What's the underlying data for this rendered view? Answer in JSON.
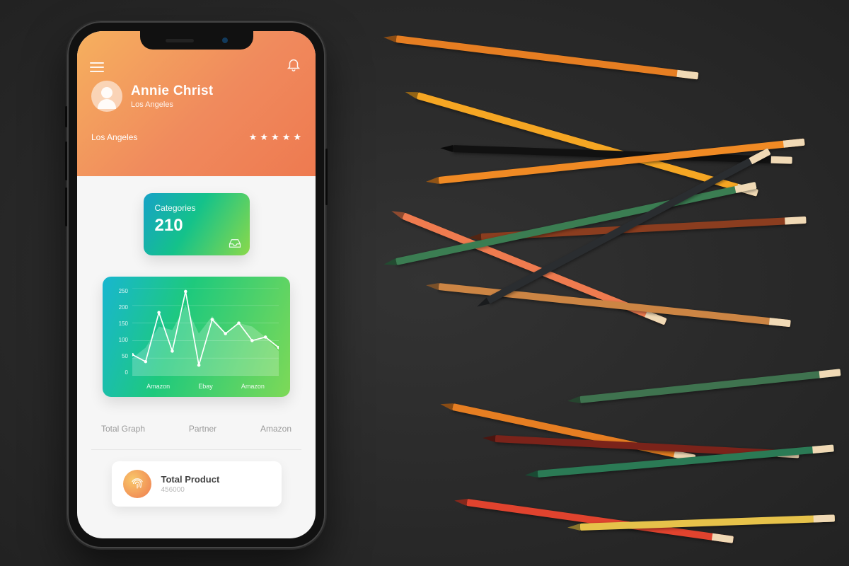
{
  "profile": {
    "name": "Annie Christ",
    "location": "Los Angeles"
  },
  "header": {
    "location_repeat": "Los Angeles",
    "stars": 5
  },
  "categories": {
    "label": "Categories",
    "value": "210"
  },
  "chart_data": {
    "type": "line",
    "x_categories": [
      "Amazon",
      "Ebay",
      "Amazon"
    ],
    "y_ticks": [
      250,
      200,
      150,
      100,
      50,
      0
    ],
    "ylim": [
      0,
      250
    ],
    "series": [
      {
        "name": "line",
        "values": [
          60,
          40,
          180,
          70,
          240,
          30,
          160,
          120,
          150,
          100,
          110,
          80
        ]
      },
      {
        "name": "area",
        "values": [
          50,
          80,
          140,
          130,
          200,
          120,
          170,
          120,
          150,
          140,
          110,
          70
        ]
      }
    ]
  },
  "tabs": {
    "items": [
      {
        "label": "Total Graph"
      },
      {
        "label": "Partner"
      },
      {
        "label": "Amazon"
      }
    ]
  },
  "total_product": {
    "label": "Total Product",
    "value": "456000"
  },
  "colors": {
    "header_grad_a": "#f6b05e",
    "header_grad_b": "#ee7a50",
    "card_grad_a": "#17a2c7",
    "card_grad_b": "#8bd94a"
  },
  "pencils": [
    {
      "left": 560,
      "top": 50,
      "len": 430,
      "rot": 7,
      "color": "#e67e22"
    },
    {
      "left": 590,
      "top": 130,
      "len": 500,
      "rot": 16,
      "color": "#f5a623"
    },
    {
      "left": 640,
      "top": 205,
      "len": 480,
      "rot": 2,
      "color": "#111111"
    },
    {
      "left": 620,
      "top": 250,
      "len": 520,
      "rot": -6,
      "color": "#f08a24"
    },
    {
      "left": 570,
      "top": 300,
      "len": 400,
      "rot": 22,
      "color": "#ef7b4f"
    },
    {
      "left": 680,
      "top": 330,
      "len": 460,
      "rot": -3,
      "color": "#8b3d1f"
    },
    {
      "left": 560,
      "top": 365,
      "len": 520,
      "rot": -12,
      "color": "#3b7d52"
    },
    {
      "left": 620,
      "top": 400,
      "len": 500,
      "rot": 6,
      "color": "#cc8544"
    },
    {
      "left": 690,
      "top": 420,
      "len": 450,
      "rot": -28,
      "color": "#2a2d30"
    },
    {
      "left": 820,
      "top": 560,
      "len": 370,
      "rot": -6,
      "color": "#3f734f"
    },
    {
      "left": 640,
      "top": 570,
      "len": 350,
      "rot": 12,
      "color": "#e67e22"
    },
    {
      "left": 700,
      "top": 615,
      "len": 430,
      "rot": 3,
      "color": "#7b231a"
    },
    {
      "left": 760,
      "top": 665,
      "len": 420,
      "rot": -5,
      "color": "#2b7a55"
    },
    {
      "left": 660,
      "top": 705,
      "len": 380,
      "rot": 8,
      "color": "#e0432e"
    },
    {
      "left": 820,
      "top": 740,
      "len": 360,
      "rot": -2,
      "color": "#e6c24a"
    }
  ]
}
